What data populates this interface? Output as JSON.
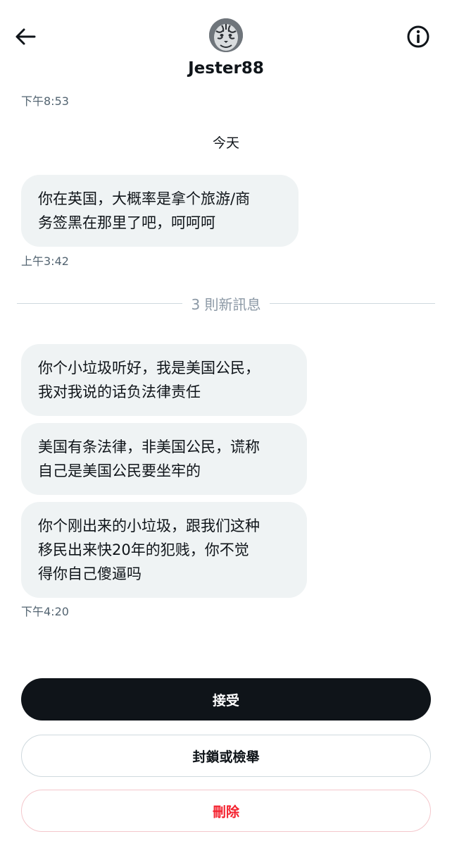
{
  "header": {
    "username": "Jester88",
    "back_icon": "arrow-left-icon",
    "info_icon": "info-circle-icon",
    "avatar": "tiger-avatar"
  },
  "messages": {
    "earlier_timestamp": "下午8:53",
    "day_label": "今天",
    "first_group": {
      "lines": [
        "你在英国，大概率是拿个旅游/商",
        "务签黑在那里了吧，呵呵呵"
      ],
      "timestamp": "上午3:42"
    },
    "new_messages_label": "3 則新訊息",
    "second_group": [
      {
        "lines": [
          "你个小垃圾听好，我是美国公民，",
          "我对我说的话负法律责任"
        ]
      },
      {
        "lines": [
          "美国有条法律，非美国公民，谎称",
          "自己是美国公民要坐牢的"
        ]
      },
      {
        "lines": [
          "你个刚出来的小垃圾，跟我们这种",
          "移民出来快20年的犯贱，你不觉",
          "得你自己傻逼吗"
        ]
      }
    ],
    "second_timestamp": "下午4:20"
  },
  "actions": {
    "accept": "接受",
    "block_report": "封鎖或檢舉",
    "delete": "刪除"
  },
  "colors": {
    "bubble_bg": "#eff3f4",
    "primary_button": "#0f1419",
    "danger": "#f4212e",
    "muted_text": "#536471"
  }
}
